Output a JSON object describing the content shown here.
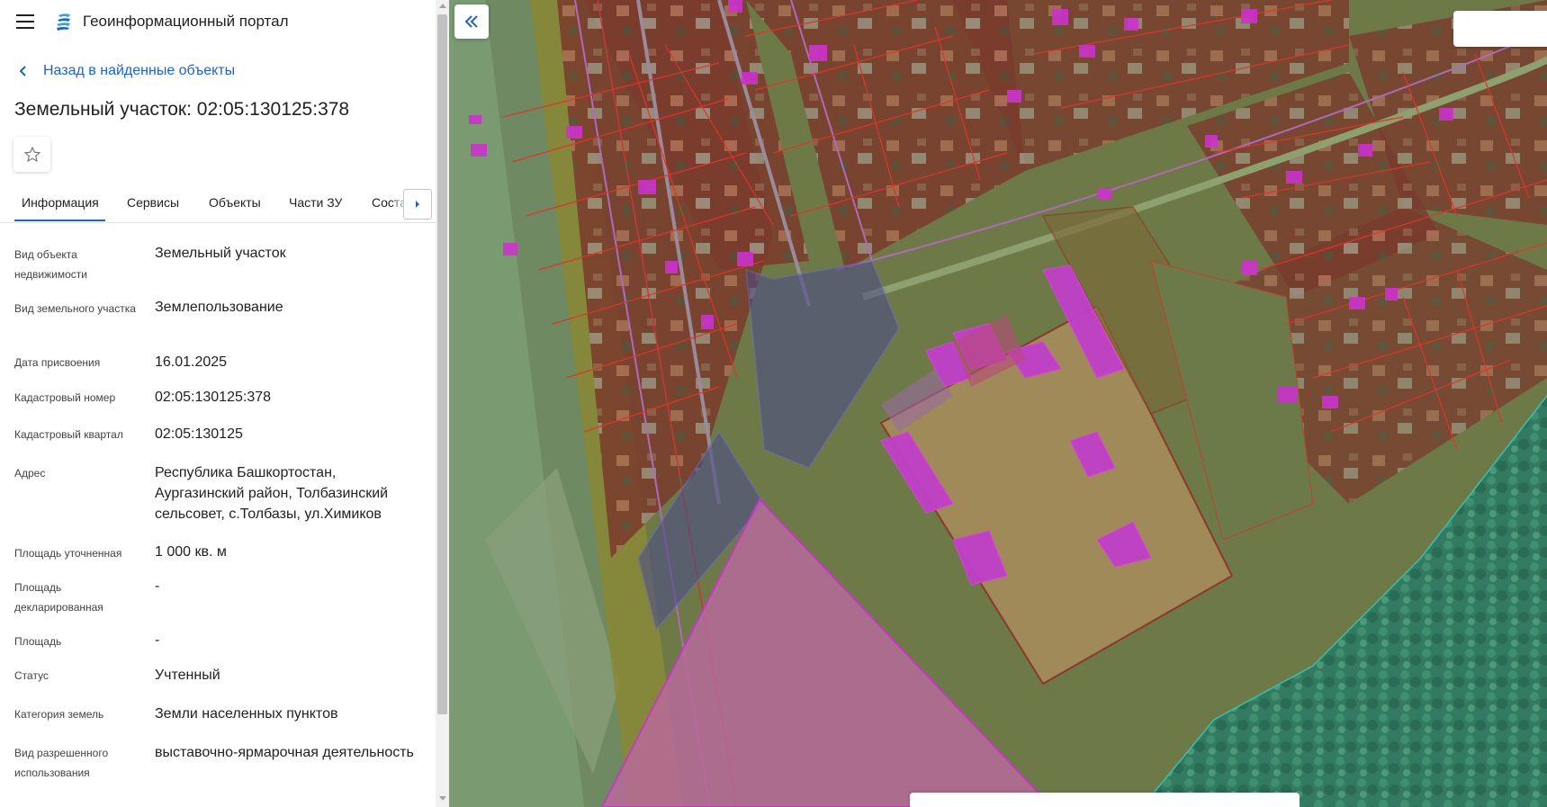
{
  "header": {
    "app_title": "Геоинформационный портал"
  },
  "nav": {
    "back_label": "Назад в найденные объекты"
  },
  "object": {
    "title": "Земельный участок: 02:05:130125:378"
  },
  "tabs": [
    {
      "label": "Информация",
      "active": true
    },
    {
      "label": "Сервисы"
    },
    {
      "label": "Объекты"
    },
    {
      "label": "Части ЗУ"
    },
    {
      "label": "Соста"
    }
  ],
  "properties": [
    {
      "label": "Вид объекта недвижимости",
      "value": "Земельный участок"
    },
    {
      "label": "Вид земельного участка",
      "value": "Землепользование"
    },
    {
      "label": "Дата присвоения",
      "value": "16.01.2025"
    },
    {
      "label": "Кадастровый номер",
      "value": "02:05:130125:378"
    },
    {
      "label": "Кадастровый квартал",
      "value": "02:05:130125"
    },
    {
      "label": "Адрес",
      "value": "Республика Башкортостан, Аургазинский район, Толбазинский сельсовет, с.Толбазы, ул.Химиков"
    },
    {
      "label": "Площадь уточненная",
      "value": "1 000 кв. м"
    },
    {
      "label": "Площадь декларированная",
      "value": "-"
    },
    {
      "label": "Площадь",
      "value": "-"
    },
    {
      "label": "Статус",
      "value": "Учтенный"
    },
    {
      "label": "Категория земель",
      "value": "Земли населенных пунктов"
    },
    {
      "label": "Вид разрешенного использования",
      "value": "выставочно-ярмарочная деятельность"
    }
  ],
  "colors": {
    "accent": "#1e63c8",
    "parcel_outline": "#e0342a",
    "building": "#cc33cc",
    "selected_parcel": "#4a4a8a"
  },
  "icons": {
    "menu": "hamburger-icon",
    "logo": "portal-logo-icon",
    "back": "chevron-left-icon",
    "favorite": "star-outline-icon",
    "tabs_next": "chevron-right-icon",
    "collapse": "double-chevron-left-icon"
  }
}
